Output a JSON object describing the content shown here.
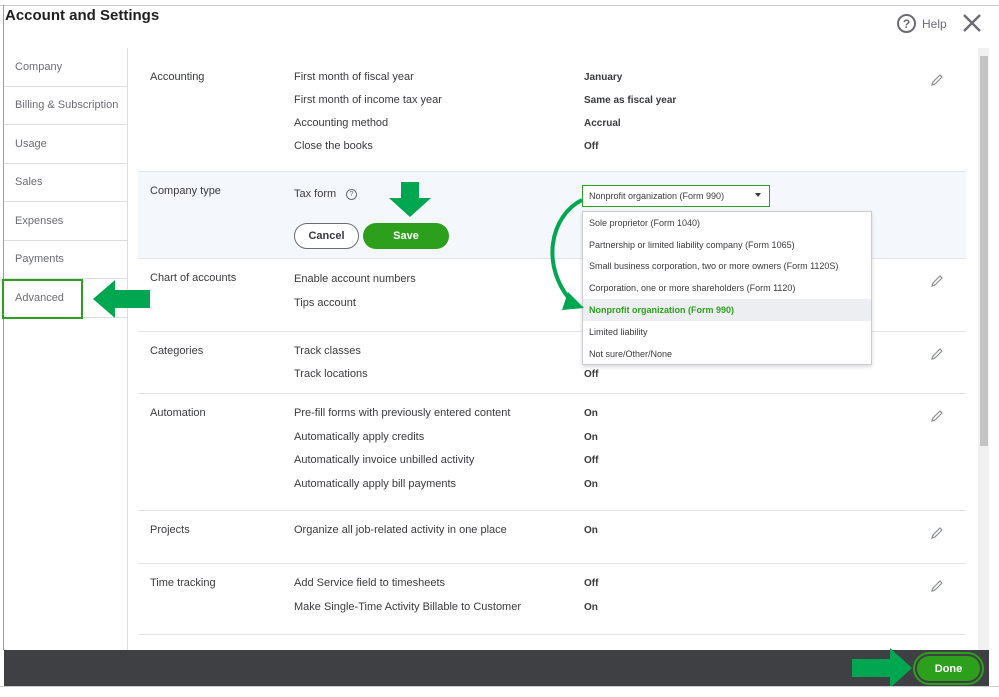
{
  "window": {
    "title": "Account and Settings",
    "help_label": "Help",
    "help_glyph": "?"
  },
  "sidebar": {
    "items": [
      {
        "label": "Company"
      },
      {
        "label": "Billing & Subscription"
      },
      {
        "label": "Usage"
      },
      {
        "label": "Sales"
      },
      {
        "label": "Expenses"
      },
      {
        "label": "Payments"
      },
      {
        "label": "Advanced"
      }
    ]
  },
  "sections": {
    "accounting": {
      "title": "Accounting",
      "rows": [
        {
          "label": "First month of fiscal year",
          "value": "January"
        },
        {
          "label": "First month of income tax year",
          "value": "Same as fiscal year"
        },
        {
          "label": "Accounting method",
          "value": "Accrual"
        },
        {
          "label": "Close the books",
          "value": "Off"
        }
      ]
    },
    "company_type": {
      "title": "Company type",
      "tax_form_label": "Tax form",
      "help_glyph": "?",
      "selected_value": "Nonprofit organization (Form 990)",
      "cancel_label": "Cancel",
      "save_label": "Save",
      "options": [
        "Sole proprietor (Form 1040)",
        "Partnership or limited liability company (Form 1065)",
        "Small business corporation, two or more owners (Form 1120S)",
        "Corporation, one or more shareholders (Form 1120)",
        "Nonprofit organization (Form 990)",
        "Limited liability",
        "Not sure/Other/None"
      ]
    },
    "chart_of_accounts": {
      "title": "Chart of accounts",
      "rows": [
        {
          "label": "Enable account numbers"
        },
        {
          "label": "Tips account"
        }
      ]
    },
    "categories": {
      "title": "Categories",
      "rows": [
        {
          "label": "Track classes",
          "value": ""
        },
        {
          "label": "Track locations",
          "value": "Off"
        }
      ]
    },
    "automation": {
      "title": "Automation",
      "rows": [
        {
          "label": "Pre-fill forms with previously entered content",
          "value": "On"
        },
        {
          "label": "Automatically apply credits",
          "value": "On"
        },
        {
          "label": "Automatically invoice unbilled activity",
          "value": "Off"
        },
        {
          "label": "Automatically apply bill payments",
          "value": "On"
        }
      ]
    },
    "projects": {
      "title": "Projects",
      "rows": [
        {
          "label": "Organize all job-related activity in one place",
          "value": "On"
        }
      ]
    },
    "time_tracking": {
      "title": "Time tracking",
      "rows": [
        {
          "label": "Add Service field to timesheets",
          "value": "Off"
        },
        {
          "label": "Make Single-Time Activity Billable to Customer",
          "value": "On"
        }
      ]
    }
  },
  "footer": {
    "done_label": "Done"
  },
  "colors": {
    "accent_green": "#2ca01c",
    "annotation_green": "#00a650",
    "footer_bg": "#3f4043"
  },
  "icons": {
    "help": "help-circle-icon",
    "close": "close-icon",
    "edit": "pencil-icon",
    "annotation": "green-arrow-icon"
  }
}
